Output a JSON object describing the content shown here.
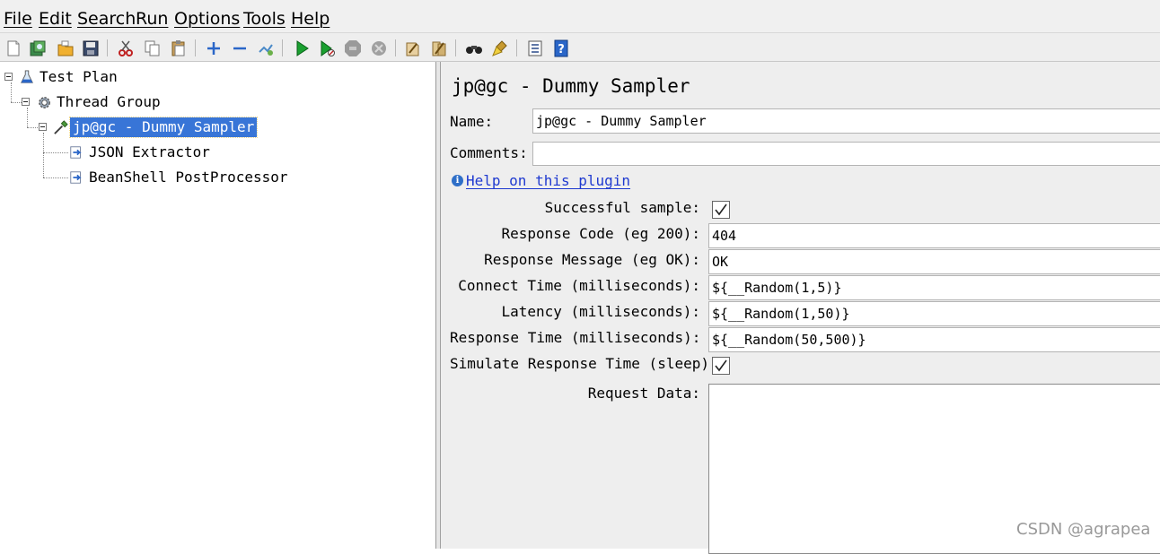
{
  "menu": {
    "items": [
      {
        "label": "File"
      },
      {
        "label": "Edit"
      },
      {
        "label": "Search"
      },
      {
        "label": "Run"
      },
      {
        "label": "Options"
      },
      {
        "label": "Tools"
      },
      {
        "label": "Help"
      }
    ]
  },
  "toolbar": {
    "icons": [
      "new-icon",
      "templates-icon",
      "open-icon",
      "save-icon",
      "cut-icon",
      "copy-icon",
      "paste-icon",
      "expand-icon",
      "collapse-icon",
      "toggle-icon",
      "start-icon",
      "start-no-pauses-icon",
      "stop-icon",
      "shutdown-icon",
      "clear-icon",
      "clear-all-icon",
      "search-icon",
      "reset-search-icon",
      "function-helper-icon",
      "help-icon"
    ]
  },
  "tree": {
    "nodes": [
      {
        "label": "Test Plan",
        "icon": "test-plan-icon"
      },
      {
        "label": "Thread Group",
        "icon": "gear-icon"
      },
      {
        "label": "jp@gc - Dummy Sampler",
        "icon": "pipette-icon",
        "selected": true
      },
      {
        "label": "JSON Extractor",
        "icon": "postprocessor-icon"
      },
      {
        "label": "BeanShell PostProcessor",
        "icon": "postprocessor-icon"
      }
    ]
  },
  "panel": {
    "title": "jp@gc - Dummy Sampler",
    "name_label": "Name:",
    "name_value": "jp@gc - Dummy Sampler",
    "comments_label": "Comments:",
    "comments_value": "",
    "help_link": "Help on this plugin",
    "successful_label": "Successful sample:",
    "successful_checked": true,
    "response_code_label": "Response Code (eg 200):",
    "response_code_value": "404",
    "response_message_label": "Response Message (eg OK):",
    "response_message_value": "OK",
    "connect_time_label": "Connect Time (milliseconds):",
    "connect_time_value": "${__Random(1,5)}",
    "latency_label": "Latency (milliseconds):",
    "latency_value": "${__Random(1,50)}",
    "response_time_label": "Response Time (milliseconds):",
    "response_time_value": "${__Random(50,500)}",
    "simulate_label": "Simulate Response Time (sleep):",
    "simulate_checked": true,
    "request_data_label": "Request Data:",
    "request_data_value": ""
  },
  "watermark": "CSDN @agrapea",
  "colors": {
    "selection": "#3875d7",
    "link": "#1f3ad0",
    "panel_bg": "#eeeeee"
  }
}
